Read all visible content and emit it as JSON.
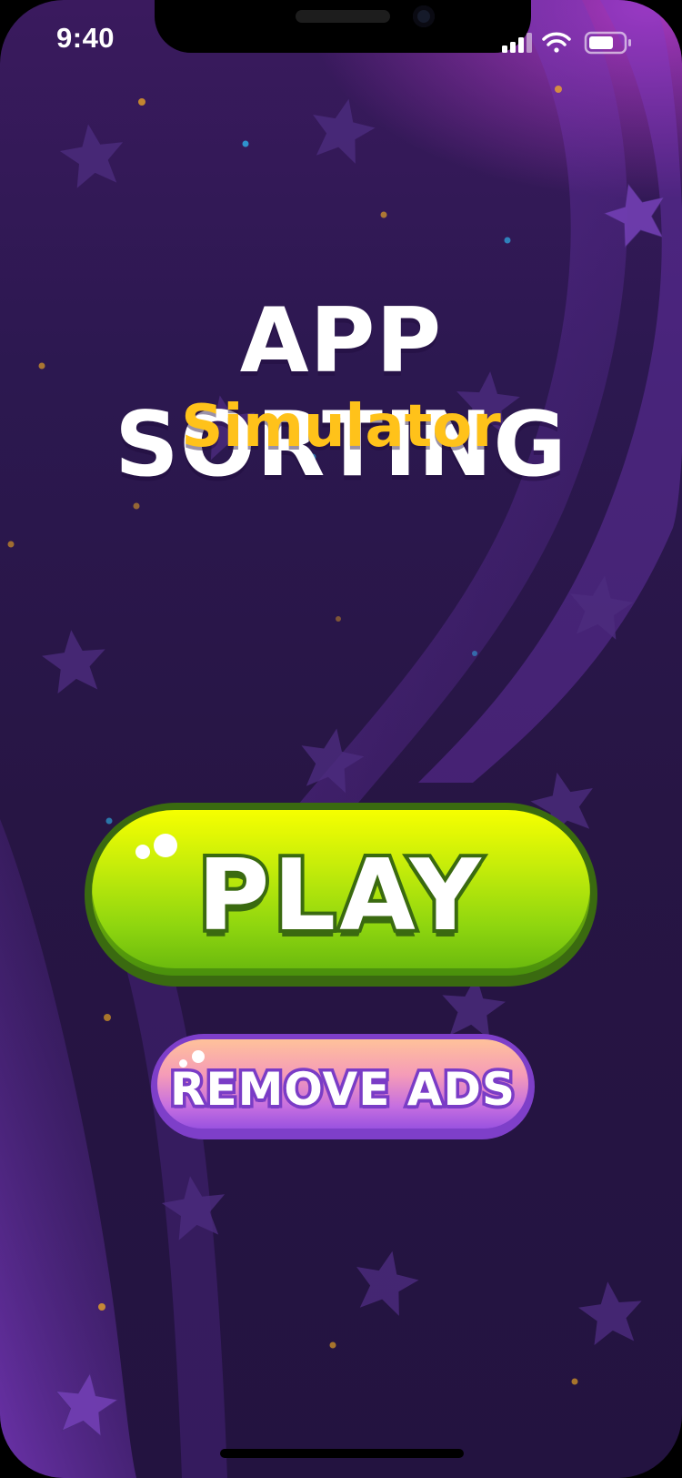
{
  "status_bar": {
    "time": "9:40"
  },
  "title": {
    "main": "APP SORTING",
    "subtitle": "Simulator"
  },
  "buttons": {
    "play_label": "PLAY",
    "remove_ads_label": "REMOVE ADS"
  },
  "colors": {
    "background": "#2a1650",
    "title_accent": "#ffc21a",
    "play_button": "#8fd60f",
    "remove_ads_button": "#c66fe0"
  }
}
